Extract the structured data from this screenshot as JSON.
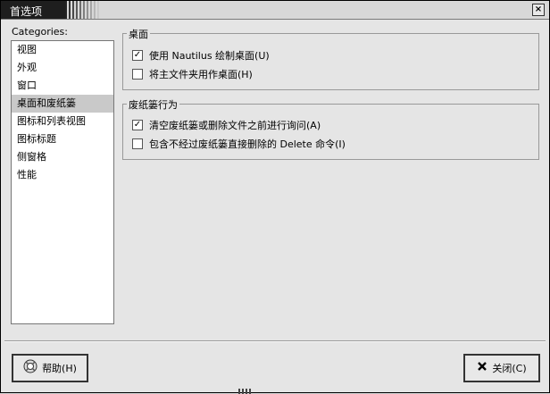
{
  "window": {
    "title": "首选项",
    "close_glyph": "×"
  },
  "sidebar": {
    "label": "Categories:",
    "items": [
      {
        "label": "视图"
      },
      {
        "label": "外观"
      },
      {
        "label": "窗口"
      },
      {
        "label": "桌面和废纸篓",
        "selected": true
      },
      {
        "label": "图标和列表视图"
      },
      {
        "label": "图标标题"
      },
      {
        "label": "侧窗格"
      },
      {
        "label": "性能"
      }
    ]
  },
  "desktop_group": {
    "title": "桌面",
    "options": [
      {
        "label": "使用 Nautilus 绘制桌面(U)",
        "checked": true
      },
      {
        "label": "将主文件夹用作桌面(H)",
        "checked": false
      }
    ]
  },
  "trash_group": {
    "title": "废纸篓行为",
    "options": [
      {
        "label": "清空废纸篓或删除文件之前进行询问(A)",
        "checked": true
      },
      {
        "label": "包含不经过废纸篓直接删除的 Delete 命令(I)",
        "checked": false
      }
    ]
  },
  "buttons": {
    "help": {
      "label": "帮助(H)",
      "icon": "help-icon"
    },
    "close": {
      "label": "关闭(C)",
      "icon": "close-x-icon"
    }
  }
}
